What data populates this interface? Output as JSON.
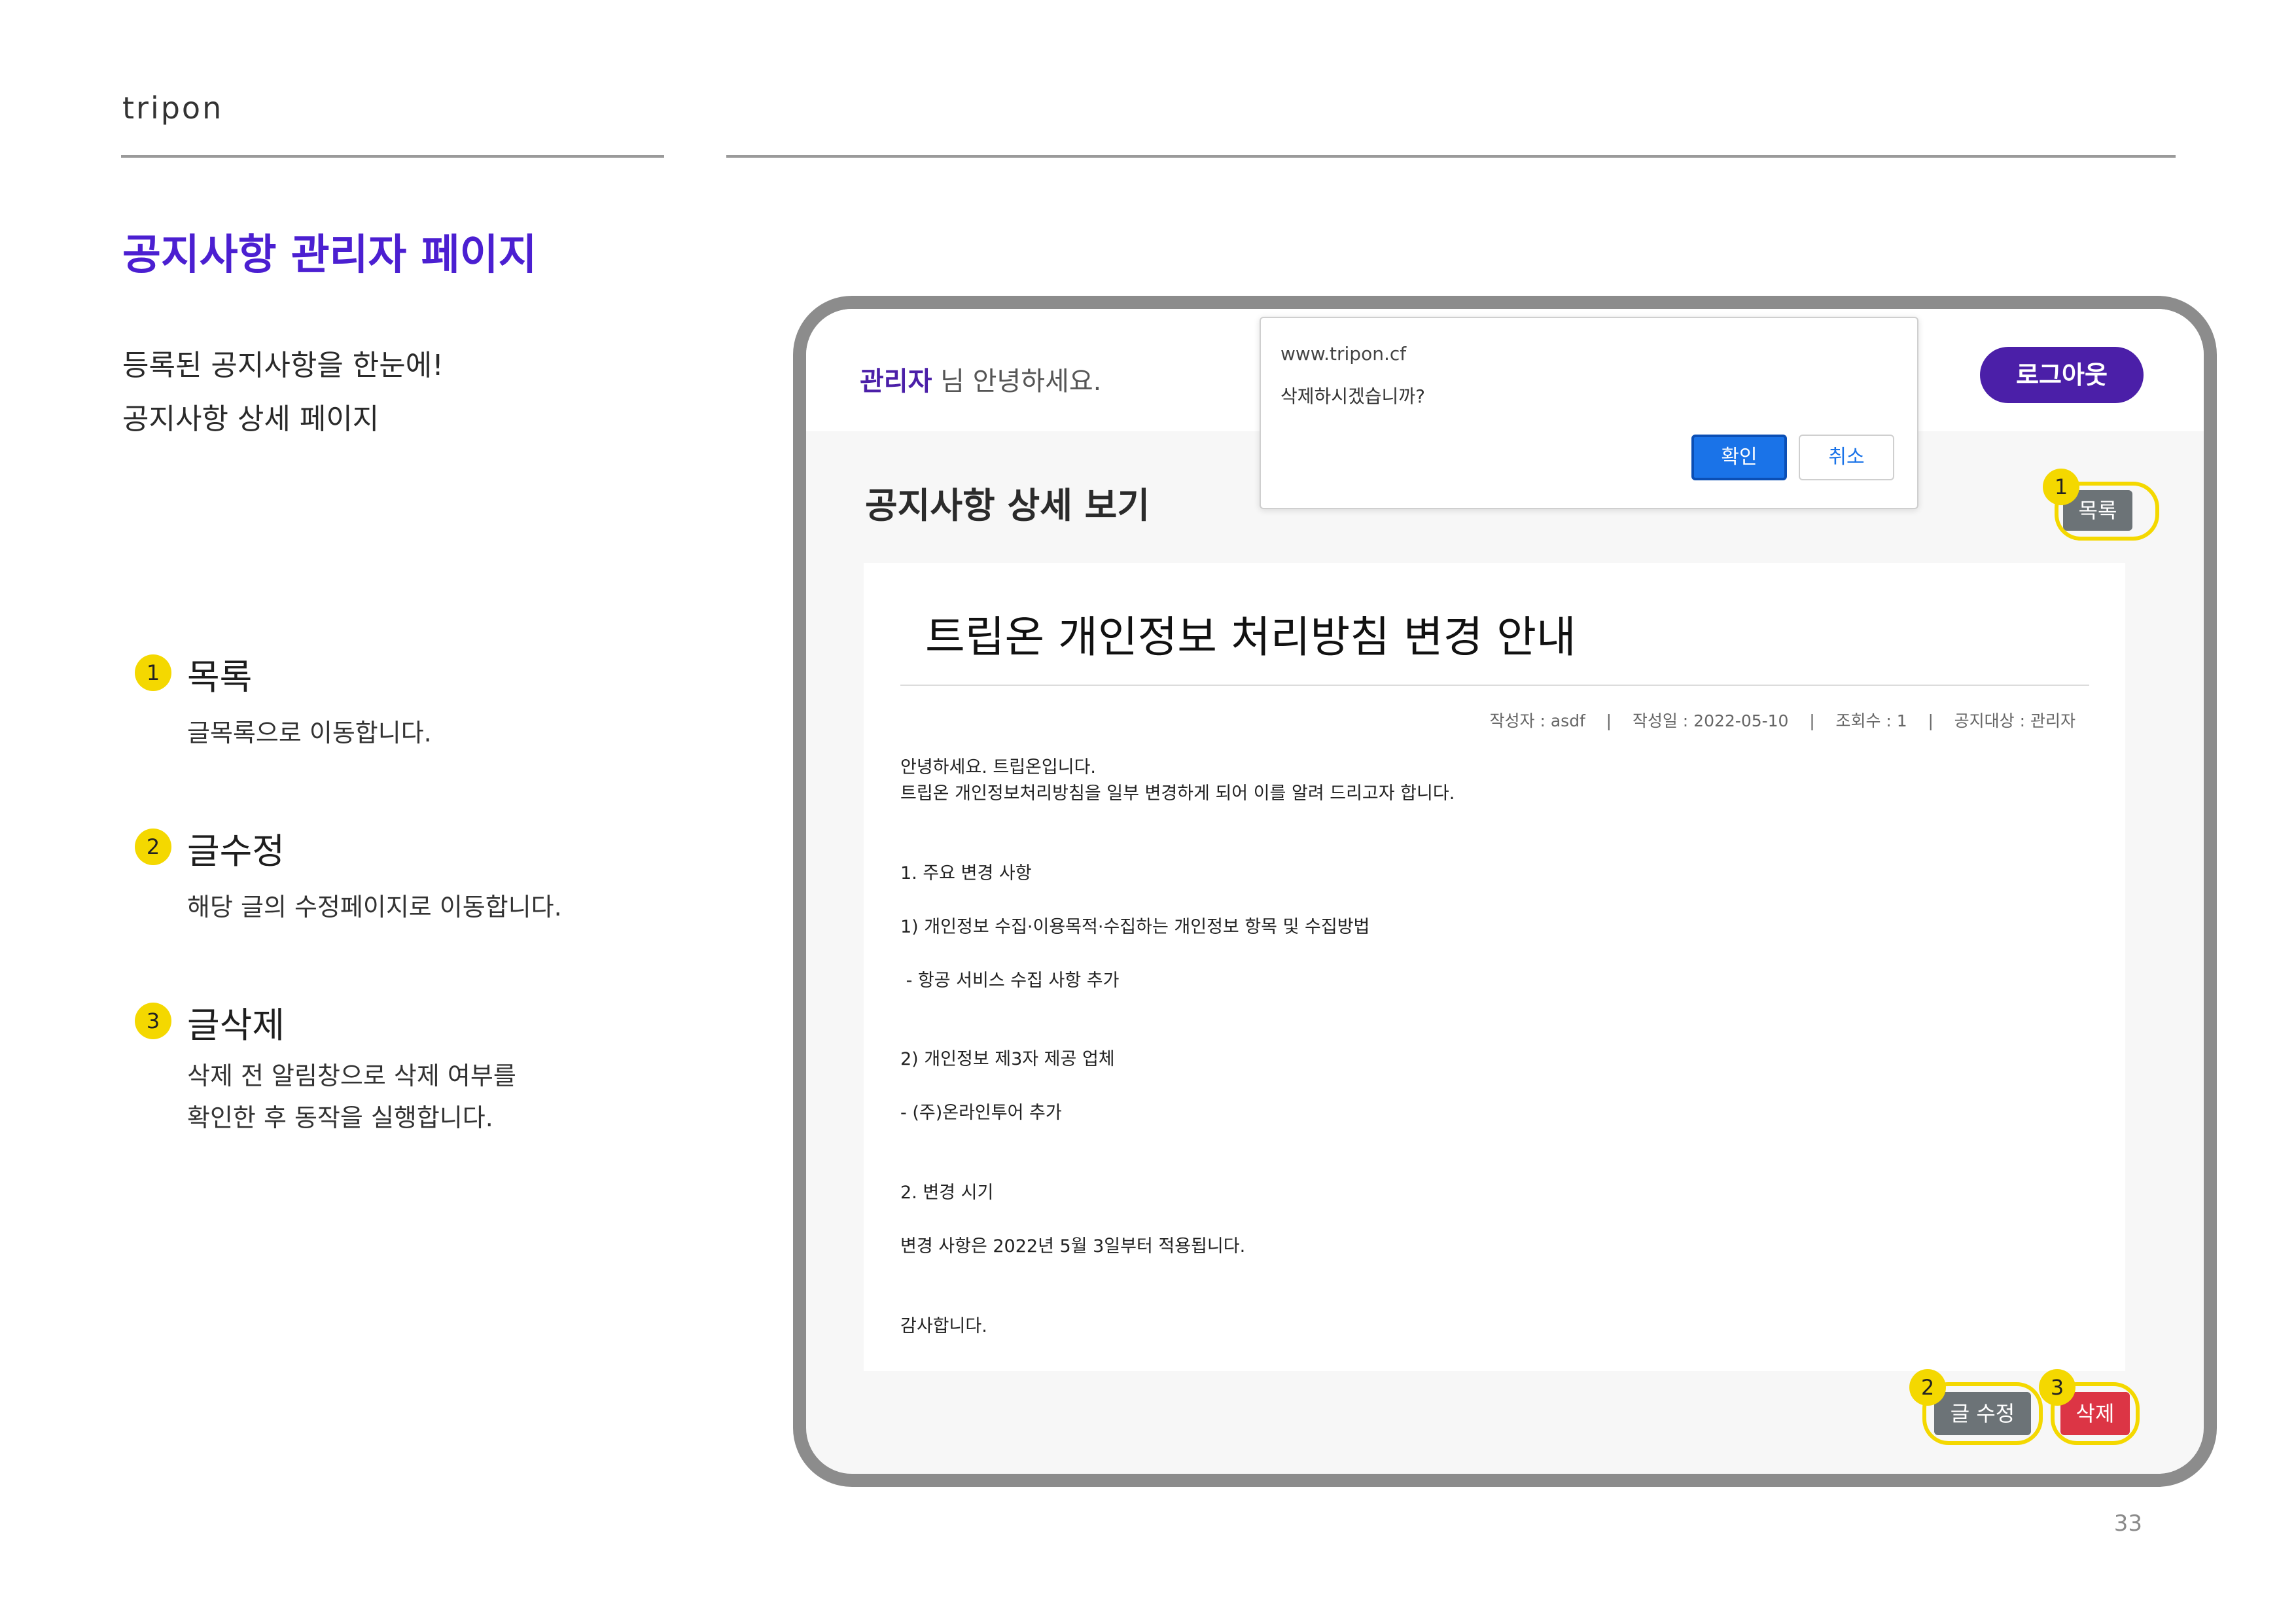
{
  "brand": "tripon",
  "page_title": "공지사항 관리자 페이지",
  "intro": [
    "등록된 공지사항을 한눈에!",
    "공지사항 상세 페이지"
  ],
  "steps": [
    {
      "num": "1",
      "title": "목록",
      "desc": [
        "글목록으로 이동합니다."
      ]
    },
    {
      "num": "2",
      "title": "글수정",
      "desc": [
        "해당 글의 수정페이지로 이동합니다."
      ]
    },
    {
      "num": "3",
      "title": "글삭제",
      "desc": [
        "삭제 전 알림창으로 삭제 여부를",
        "확인한 후 동작을 실행합니다."
      ]
    }
  ],
  "page_number": "33",
  "app": {
    "greeting_name": "관리자",
    "greeting_suffix": " 님 안녕하세요.",
    "logout_label": "로그아웃",
    "detail_title": "공지사항 상세 보기",
    "list_label": "목록",
    "edit_label": "글 수정",
    "delete_label": "삭제",
    "post": {
      "title": "트립온 개인정보 처리방침 변경 안내",
      "meta": "작성자 : asdf    |    작성일 : 2022-05-10    |    조회수 : 1    |    공지대상 : 관리자",
      "lines": [
        "안녕하세요. 트립온입니다.",
        "트립온 개인정보처리방침을 일부 변경하게 되어 이를 알려 드리고자 합니다.",
        "1. 주요 변경 사항",
        "1) 개인정보 수집·이용목적·수집하는 개인정보 항목 및 수집방법",
        " - 항공 서비스 수집 사항 추가",
        "2) 개인정보 제3자 제공 업체",
        "- (주)온라인투어 추가",
        "2. 변경 시기",
        "변경 사항은 2022년 5월 3일부터 적용됩니다.",
        "감사합니다."
      ]
    },
    "dialog": {
      "host": "www.tripon.cf",
      "message": "삭제하시겠습니까?",
      "ok_label": "확인",
      "cancel_label": "취소"
    },
    "callouts": [
      "1",
      "2",
      "3"
    ]
  },
  "colors": {
    "accent": "#4b1fd1",
    "highlight": "#f4d800",
    "danger": "#dc3545",
    "secondary": "#6c7377"
  }
}
